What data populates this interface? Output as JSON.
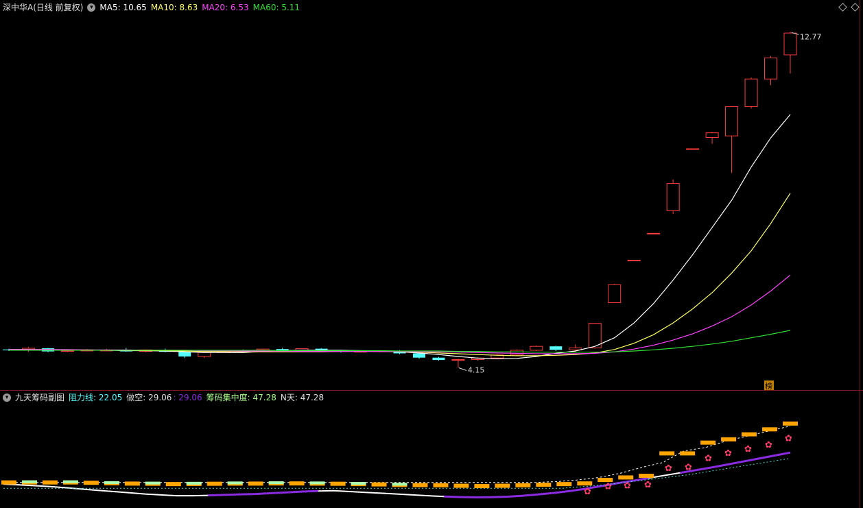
{
  "main_header": {
    "title": "深中华A(日线 前复权)",
    "ma5_label": "MA5: 10.65",
    "ma10_label": "MA10: 8.63",
    "ma20_label": "MA20: 6.53",
    "ma60_label": "MA60: 5.11"
  },
  "sub_header": {
    "title": "九天筹码副图",
    "resist_label": "阻力线: 22.05",
    "short_label": "做空: 29.06",
    "short2_label": ": 29.06",
    "conc_label": "筹码集中度: 47.28",
    "nday_label": "N天: 47.28"
  },
  "colors": {
    "up": "#ff3c3c",
    "down": "#54ffff",
    "ma5": "#ffffff",
    "ma10": "#ffff60",
    "ma20": "#ff40ff",
    "ma60": "#30e030",
    "orange": "#ffa400",
    "purple": "#8a2be2",
    "teal": "#40e0d0",
    "butterfly": "#ff3c6a"
  },
  "chart_data": [
    {
      "type": "candlestick",
      "title": "深中华A(日线 前复权)",
      "max_label": "12.77",
      "min_label": "4.15",
      "corner_tag": "榜",
      "candles": [
        [
          4.62,
          4.64,
          4.58,
          4.6
        ],
        [
          4.6,
          4.68,
          4.56,
          4.65
        ],
        [
          4.65,
          4.66,
          4.55,
          4.57
        ],
        [
          4.57,
          4.6,
          4.55,
          4.59
        ],
        [
          4.59,
          4.63,
          4.57,
          4.6
        ],
        [
          4.6,
          4.64,
          4.58,
          4.6
        ],
        [
          4.6,
          4.66,
          4.56,
          4.57
        ],
        [
          4.57,
          4.62,
          4.55,
          4.61
        ],
        [
          4.61,
          4.64,
          4.55,
          4.56
        ],
        [
          4.56,
          4.57,
          4.4,
          4.44
        ],
        [
          4.44,
          4.55,
          4.4,
          4.54
        ],
        [
          4.54,
          4.6,
          4.53,
          4.58
        ],
        [
          4.58,
          4.62,
          4.55,
          4.57
        ],
        [
          4.57,
          4.64,
          4.56,
          4.63
        ],
        [
          4.63,
          4.66,
          4.58,
          4.59
        ],
        [
          4.59,
          4.65,
          4.58,
          4.64
        ],
        [
          4.64,
          4.65,
          4.58,
          4.59
        ],
        [
          4.59,
          4.6,
          4.54,
          4.56
        ],
        [
          4.56,
          4.58,
          4.54,
          4.57
        ],
        [
          4.57,
          4.6,
          4.55,
          4.58
        ],
        [
          4.58,
          4.6,
          4.5,
          4.52
        ],
        [
          4.52,
          4.53,
          4.38,
          4.41
        ],
        [
          4.41,
          4.43,
          4.33,
          4.35
        ],
        [
          4.35,
          4.38,
          4.15,
          4.36
        ],
        [
          4.36,
          4.42,
          4.33,
          4.4
        ],
        [
          4.4,
          4.5,
          4.39,
          4.48
        ],
        [
          4.48,
          4.62,
          4.46,
          4.6
        ],
        [
          4.6,
          4.72,
          4.58,
          4.7
        ],
        [
          4.7,
          4.72,
          4.58,
          4.61
        ],
        [
          4.61,
          4.75,
          4.55,
          4.66
        ],
        [
          4.66,
          5.3,
          4.64,
          5.29
        ],
        [
          5.82,
          6.3,
          5.82,
          6.28
        ],
        [
          6.91,
          6.91,
          6.91,
          6.91
        ],
        [
          7.6,
          7.6,
          7.6,
          7.6
        ],
        [
          8.18,
          8.98,
          8.1,
          8.88
        ],
        [
          9.77,
          9.77,
          9.77,
          9.77
        ],
        [
          10.06,
          10.2,
          9.9,
          10.18
        ],
        [
          10.1,
          10.35,
          9.15,
          10.85
        ],
        [
          10.85,
          11.6,
          10.8,
          11.56
        ],
        [
          11.56,
          12.15,
          11.4,
          12.1
        ],
        [
          12.18,
          12.77,
          11.7,
          12.74
        ]
      ],
      "ma5": [
        4.62,
        4.62,
        4.61,
        4.6,
        4.6,
        4.6,
        4.59,
        4.59,
        4.58,
        4.56,
        4.54,
        4.54,
        4.54,
        4.57,
        4.59,
        4.6,
        4.6,
        4.6,
        4.59,
        4.58,
        4.56,
        4.53,
        4.49,
        4.44,
        4.4,
        4.38,
        4.39,
        4.44,
        4.52,
        4.58,
        4.7,
        4.92,
        5.3,
        5.8,
        6.4,
        7.05,
        7.75,
        8.45,
        9.3,
        10.05,
        10.65
      ],
      "ma10": [
        4.62,
        4.62,
        4.62,
        4.61,
        4.61,
        4.6,
        4.6,
        4.59,
        4.59,
        4.58,
        4.57,
        4.57,
        4.56,
        4.56,
        4.56,
        4.56,
        4.56,
        4.57,
        4.57,
        4.57,
        4.56,
        4.55,
        4.53,
        4.51,
        4.49,
        4.47,
        4.46,
        4.46,
        4.47,
        4.49,
        4.53,
        4.62,
        4.78,
        5.0,
        5.3,
        5.66,
        6.08,
        6.58,
        7.15,
        7.85,
        8.63
      ],
      "ma20": [
        4.62,
        4.62,
        4.62,
        4.62,
        4.61,
        4.61,
        4.61,
        4.6,
        4.6,
        4.6,
        4.59,
        4.59,
        4.58,
        4.58,
        4.58,
        4.57,
        4.57,
        4.57,
        4.57,
        4.57,
        4.57,
        4.56,
        4.56,
        4.55,
        4.54,
        4.53,
        4.52,
        4.51,
        4.51,
        4.51,
        4.52,
        4.56,
        4.63,
        4.73,
        4.86,
        5.02,
        5.22,
        5.46,
        5.76,
        6.12,
        6.53
      ],
      "ma60": [
        4.6,
        4.6,
        4.6,
        4.6,
        4.6,
        4.6,
        4.6,
        4.6,
        4.6,
        4.6,
        4.6,
        4.6,
        4.6,
        4.6,
        4.59,
        4.59,
        4.59,
        4.59,
        4.59,
        4.59,
        4.58,
        4.58,
        4.58,
        4.57,
        4.57,
        4.56,
        4.56,
        4.55,
        4.55,
        4.55,
        4.55,
        4.56,
        4.58,
        4.61,
        4.65,
        4.7,
        4.76,
        4.83,
        4.92,
        5.01,
        5.11
      ],
      "ylim": [
        4.0,
        13.2
      ]
    },
    {
      "type": "indicator",
      "title": "九天筹码副图",
      "ylim": [
        -2,
        60
      ],
      "white_line": [
        12.0,
        11.5,
        11.0,
        10.5,
        9.8,
        9.0,
        8.2,
        7.5,
        6.8,
        6.0,
        5.5,
        5.0,
        5.0,
        5.2,
        5.5,
        5.8,
        6.0,
        6.5,
        7.0,
        7.5,
        7.8,
        8.0,
        7.5,
        7.0,
        6.5,
        6.0,
        5.5,
        5.0,
        4.5,
        4.2,
        4.0,
        4.1,
        4.4,
        5.0,
        5.8,
        6.7,
        7.8,
        9.2,
        10.8,
        12.5,
        14.0,
        15.6,
        17.2,
        18.8,
        20.4,
        22.0,
        23.8,
        25.6,
        27.4,
        29.2,
        31.0
      ],
      "purple_from": 13,
      "purple_to": 22,
      "dash_white": [
        13.0,
        13.0,
        13.0,
        13.0,
        13.0,
        13.0,
        13.0,
        13.0,
        13.0,
        13.0,
        13.0,
        13.0,
        13.0,
        13.0,
        13.0,
        13.0,
        13.0,
        13.0,
        13.0,
        13.0,
        13.0,
        13.0,
        13.0,
        13.0,
        13.0,
        13.0,
        13.5,
        14.5,
        16.0,
        18.5,
        22.0,
        25.0,
        32.0,
        34.0,
        38.0,
        41.0,
        44.0,
        47.0
      ],
      "dash_teal": [
        9.5,
        9.5,
        9.5,
        9.5,
        9.5,
        9.5,
        9.5,
        9.5,
        9.5,
        9.5,
        9.5,
        9.5,
        9.5,
        9.5,
        9.5,
        9.5,
        9.5,
        9.5,
        9.5,
        9.5,
        9.5,
        9.5,
        9.5,
        9.5,
        9.5,
        9.5,
        9.5,
        9.5,
        10.5,
        11.5,
        13.0,
        14.5,
        16.0,
        17.5,
        19.5,
        21.5,
        23.5,
        25.5,
        27.5
      ],
      "orange_bars": [
        13,
        13,
        13,
        13,
        12.8,
        12.5,
        12.3,
        12.2,
        12.0,
        12.1,
        12.2,
        12.3,
        12.3,
        12.4,
        12.4,
        12.3,
        12.2,
        12.0,
        11.8,
        11.5,
        11.4,
        11.3,
        11.0,
        10.8,
        11.0,
        11.3,
        11.6,
        12.0,
        12.4,
        14.5,
        16.0,
        17.0,
        30.5,
        30.5,
        37.0,
        39.0,
        42.0,
        45.0,
        48.5
      ],
      "green_bars": [
        0,
        1,
        0,
        1,
        0,
        1,
        0,
        1,
        0,
        1,
        0,
        1,
        0,
        1,
        0,
        1,
        0,
        1,
        0,
        1,
        0,
        0,
        0,
        0,
        0,
        0,
        0,
        0,
        0,
        0,
        0,
        0,
        0,
        0,
        0,
        0,
        0,
        0,
        0
      ],
      "butterflies": [
        8.0,
        11.0,
        11.5,
        12.0,
        22.0,
        22.5,
        28.0,
        31.0,
        33.5,
        36.0,
        40.0
      ]
    }
  ]
}
